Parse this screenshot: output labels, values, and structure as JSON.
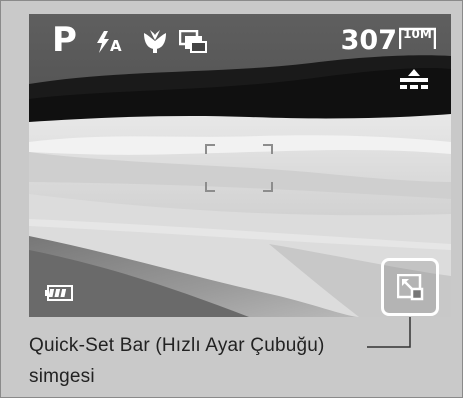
{
  "osd": {
    "mode": "P",
    "flash_mode_icon": "flash-auto-icon",
    "macro_icon": "macro-flower-icon",
    "drive_mode_icon": "continuous-shot-icon",
    "shots_remaining": "307",
    "resolution": "10M",
    "quality_icon": "quality-fine-icon",
    "battery_icon": "battery-full-icon",
    "focus_frame_icon": "focus-frame-icon",
    "quick_set_bar_icon": "quick-set-bar-icon"
  },
  "caption": {
    "line1": "Quick-Set Bar (Hızlı Ayar Çubuğu)",
    "line2": "simgesi"
  },
  "colors": {
    "frame_background": "#c9c9c9",
    "osd_text": "#ffffff",
    "highlight_border": "#ffffff",
    "callout_line": "#333333"
  }
}
